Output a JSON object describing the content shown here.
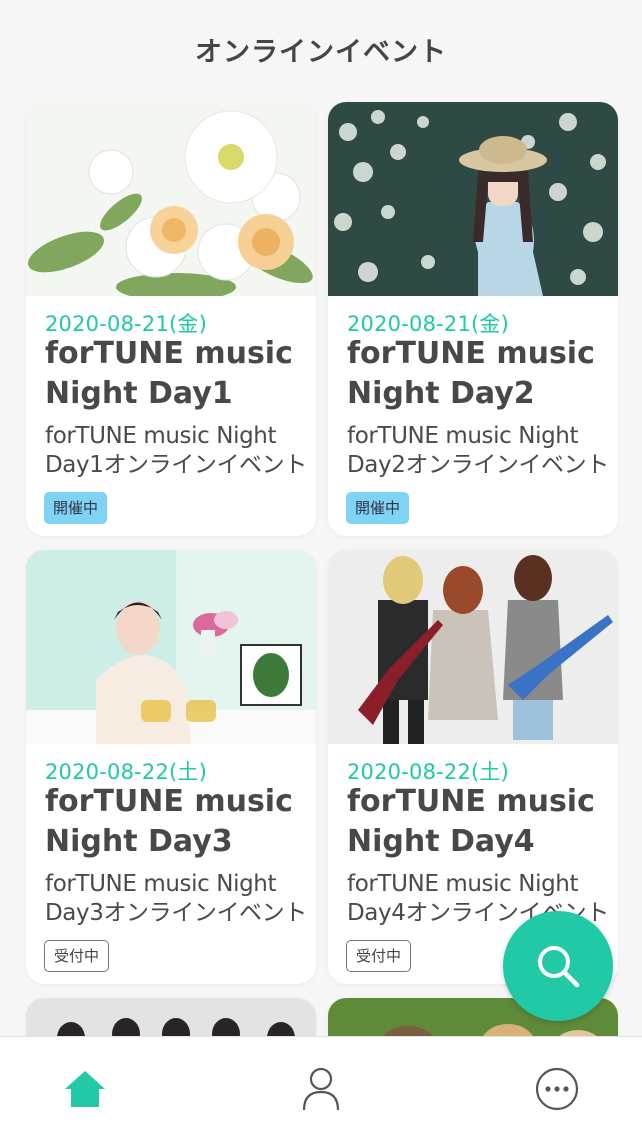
{
  "page": {
    "title": "オンラインイベント"
  },
  "events": [
    {
      "date": "2020-08-21(金)",
      "title": "forTUNE music Night Day1",
      "description": "forTUNE music Night Day1オンラインイベント",
      "status": "開催中",
      "image": "white-flower-bouquet"
    },
    {
      "date": "2020-08-21(金)",
      "title": "forTUNE music Night Day2",
      "description": "forTUNE music Night Day2オンラインイベント",
      "status": "開催中",
      "image": "woman-in-hat-with-flowers"
    },
    {
      "date": "2020-08-22(土)",
      "title": "forTUNE music Night Day3",
      "description": "forTUNE music Night Day3オンラインイベント",
      "status": "受付中",
      "image": "woman-with-tea"
    },
    {
      "date": "2020-08-22(土)",
      "title": "forTUNE music Night Day4",
      "description": "forTUNE music Night Day4オンラインイベント",
      "status": "受付中",
      "image": "girl-band-with-guitars"
    }
  ],
  "colors": {
    "accent": "#21c9a6",
    "date": "#1ec9a5",
    "badge_live": "#7fd3f5",
    "background": "#f5f6f5"
  },
  "fab": {
    "icon": "search-icon"
  },
  "tabbar": {
    "items": [
      {
        "icon": "home-icon",
        "active": true
      },
      {
        "icon": "person-icon",
        "active": false
      },
      {
        "icon": "more-icon",
        "active": false
      }
    ]
  }
}
